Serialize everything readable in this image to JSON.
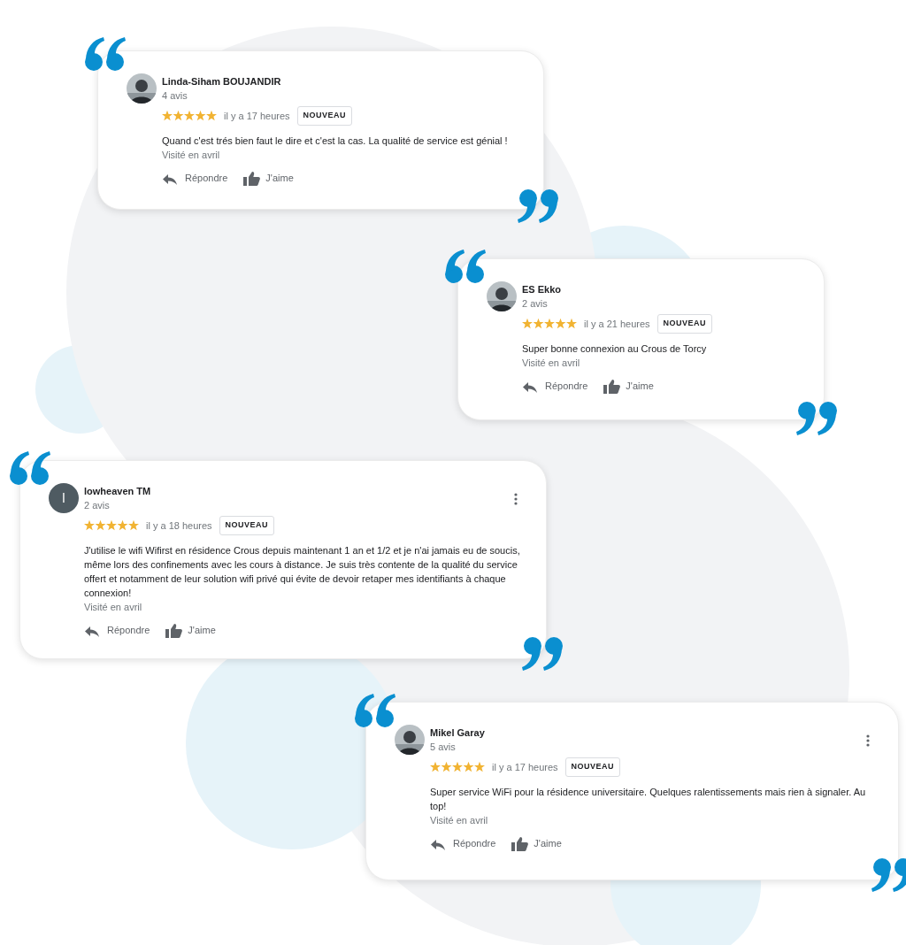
{
  "reviews": [
    {
      "name": "Linda-Siham BOUJANDIR",
      "count": "4 avis",
      "menu": false,
      "stars": 5,
      "time": "il y a 17 heures",
      "badge": "NOUVEAU",
      "text": "Quand c'est trés bien faut le dire et c'est la cas. La qualité de service est génial !",
      "visited": "Visité en avril",
      "reply": "Répondre",
      "like": "J'aime"
    },
    {
      "name": "ES Ekko",
      "count": "2 avis",
      "menu": false,
      "stars": 5,
      "time": "il y a 21 heures",
      "badge": "NOUVEAU",
      "text": "Super bonne connexion au Crous de Torcy",
      "visited": "Visité en avril",
      "reply": "Répondre",
      "like": "J'aime"
    },
    {
      "name": "lowheaven TM",
      "count": "2 avis",
      "avatar": {
        "kind": "initial",
        "initial": "l"
      },
      "menu": true,
      "stars": 5,
      "time": "il y a 18 heures",
      "badge": "NOUVEAU",
      "text": "J'utilise le wifi Wifirst en résidence Crous depuis maintenant 1 an et 1/2 et je n'ai jamais eu de soucis, même lors des confinements avec les cours à distance. Je suis très contente de la qualité du service offert et notamment de leur solution wifi privé qui évite de devoir retaper mes identifiants à chaque connexion!",
      "visited": "Visité en avril",
      "reply": "Répondre",
      "like": "J'aime"
    },
    {
      "name": "Mikel Garay",
      "count": "5 avis",
      "menu": true,
      "stars": 5,
      "time": "il y a 17 heures",
      "badge": "NOUVEAU",
      "text": "Super service WiFi pour la résidence universitaire. Quelques ralentissements mais rien à signaler. Au top!",
      "visited": "Visité en avril",
      "reply": "Répondre",
      "like": "J'aime"
    }
  ]
}
